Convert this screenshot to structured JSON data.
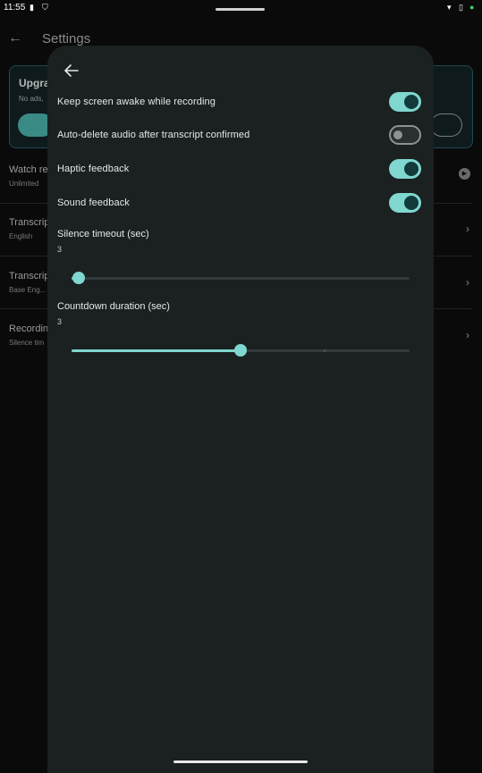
{
  "status_bar": {
    "time": "11:55",
    "sim_icon": "sim-card-icon",
    "vpn_icon": "vpn-shield-icon",
    "wifi_icon": "wifi-icon",
    "battery_icon": "battery-icon",
    "indicator_icon": "green-dot-icon"
  },
  "background": {
    "title": "Settings",
    "upgrade_title": "Upgra",
    "upgrade_sub": "No ads,",
    "rows": [
      {
        "title": "Watch re",
        "sub": "Unlimited"
      },
      {
        "title": "Transcrip",
        "sub": "English"
      },
      {
        "title": "Transcrip",
        "sub": "Base Eng..."
      },
      {
        "title": "Recordin",
        "sub": "Silence tim"
      }
    ]
  },
  "sheet": {
    "back_icon": "arrow-back-icon",
    "toggles": [
      {
        "label": "Keep screen awake while recording",
        "on": true
      },
      {
        "label": "Auto-delete audio after transcript confirmed",
        "on": false
      },
      {
        "label": "Haptic feedback",
        "on": true
      },
      {
        "label": "Sound feedback",
        "on": true
      }
    ],
    "sliders": [
      {
        "label": "Silence timeout (sec)",
        "value": "3",
        "fraction": 0.02
      },
      {
        "label": "Countdown duration (sec)",
        "value": "3",
        "fraction": 0.5
      }
    ]
  },
  "colors": {
    "accent": "#7fd7cf",
    "sheet_bg": "#1b2021",
    "background": "#0a0a0a"
  }
}
